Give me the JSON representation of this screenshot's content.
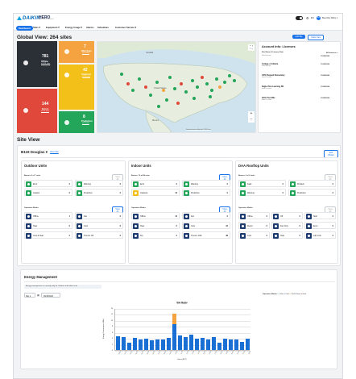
{
  "brand": {
    "logo": "DAIKIN",
    "product": "HERO",
    "product_sub": "Daikin Remote Operations"
  },
  "nav": {
    "items": [
      "Dashboard",
      "Sites ▾",
      "Equipment ▾",
      "Energy Usage ▾",
      "Alarms",
      "Schedules",
      "Customer Service ▾"
    ],
    "active": 0
  },
  "user": {
    "initials": "BW",
    "name": "Beverley Wiley ▾"
  },
  "global": {
    "title": "Global View: 264 sites",
    "add_site": "Add Site",
    "add_unit": "Scale View",
    "tiles": [
      {
        "num": "781",
        "label": "Offline",
        "sub": "of 465 sites",
        "color": "#2b2f36"
      },
      {
        "num": "7",
        "label": "Warnings",
        "sub": "at 5 sites",
        "color": "#f4a340"
      },
      {
        "num": "42",
        "label": "Cautions",
        "sub": "at 18 sites",
        "color": "#f3c019"
      },
      {
        "num": "144",
        "label": "Errors",
        "sub": "at 53 sites",
        "color": "#e0483c"
      },
      {
        "num": "8",
        "label": "Prediction",
        "sub": "at 5 sites",
        "color": "#23a55a"
      }
    ]
  },
  "map": {
    "labels": [
      "Canada",
      "United States",
      "Mexico"
    ],
    "zoom_in": "+",
    "zoom_out": "−",
    "footer": "Keyboard shortcuts  Map data ©2024  Terms"
  },
  "licenses": {
    "title": "Account Info: Licenses",
    "col_site": "Site Name & License Date",
    "col_action": "All licenses ▾",
    "rows": [
      {
        "name": "Site Name & License Date",
        "sub": "Initial license",
        "date": "11/28/2024"
      },
      {
        "name": "College of Atlanta",
        "sub": "Initial license",
        "date": "11/28/2024"
      },
      {
        "name": "CPS Shepard Elementary",
        "sub": "Initial License",
        "date": "11/28/2024"
      },
      {
        "name": "Eagle View Learning BE",
        "sub": "Initial License",
        "date": "11/28/2024"
      },
      {
        "name": "KCCI Tow Mile",
        "sub": "Initial License",
        "date": "11/28/2024"
      }
    ]
  },
  "site_view": {
    "title": "Site View",
    "site_name": "B119 Douglas ▾",
    "view_site": "View Site",
    "edit_widget": "Edit Widget"
  },
  "outdoor": {
    "title": "Outdoor Units",
    "alarms_label": "Alarms: 0 of 7 units",
    "view_all": "View All",
    "alarms": [
      {
        "t": "Error",
        "v": "0",
        "c": "#23a55a"
      },
      {
        "t": "Warning",
        "v": "0",
        "c": "#23a55a"
      },
      {
        "t": "Caution",
        "v": "0",
        "c": "#23a55a"
      },
      {
        "t": "Prediction",
        "v": "0",
        "c": "#23a55a"
      }
    ],
    "modes_label": "Operation Modes",
    "modes_view": "View All",
    "modes": [
      {
        "t": "Offline",
        "v": "1",
        "c": "#1d3b6f"
      },
      {
        "t": "Fan",
        "v": "0",
        "c": "#1d3b6f"
      },
      {
        "t": "Heat",
        "v": "0",
        "c": "#1d3b6f"
      },
      {
        "t": "Cool",
        "v": "6",
        "c": "#1d3b6f"
      },
      {
        "t": "Cool & Heat",
        "v": "0",
        "c": "#1d3b6f"
      },
      {
        "t": "Thermo Off",
        "v": "0",
        "c": "#1d3b6f"
      }
    ]
  },
  "indoor": {
    "title": "Indoor Units",
    "alarms_label": "Alarms: 13 of 84 units",
    "view_all": "View All",
    "alarms": [
      {
        "t": "Error",
        "v": "0",
        "c": "#23a55a"
      },
      {
        "t": "Warning",
        "v": "0",
        "c": "#23a55a"
      },
      {
        "t": "Cautions",
        "v": "13",
        "c": "#f3c019"
      },
      {
        "t": "Prediction",
        "v": "0",
        "c": "#23a55a"
      }
    ],
    "modes_label": "Operation Modes",
    "modes_view": "View All",
    "modes": [
      {
        "t": "Offline",
        "v": "12",
        "c": "#1d3b6f"
      },
      {
        "t": "Fan",
        "v": "0",
        "c": "#1d3b6f"
      },
      {
        "t": "Heat",
        "v": "0",
        "c": "#1d3b6f"
      },
      {
        "t": "Cool",
        "v": "34",
        "c": "#1d3b6f"
      },
      {
        "t": "Dry",
        "v": "0",
        "c": "#1d3b6f"
      },
      {
        "t": "Thermo OFF",
        "v": "38",
        "c": "#1d3b6f"
      }
    ]
  },
  "doas": {
    "title": "DAA Rooftop Units",
    "alarms_label": "Alarms: 0 of 0 units",
    "view_all": "View All",
    "alarms": [
      {
        "t": "Fault",
        "v": "0",
        "c": "#23a55a"
      },
      {
        "t": "Problem",
        "v": "0",
        "c": "#23a55a"
      },
      {
        "t": "Warning",
        "v": "0",
        "c": "#23a55a"
      },
      {
        "t": "Prediction",
        "v": "0",
        "c": "#23a55a"
      }
    ],
    "modes_label": "Operation Modes",
    "modes_view": "View All",
    "modes": [
      {
        "t": "Offline",
        "v": "0",
        "c": "#1d3b6f"
      },
      {
        "t": "Off",
        "v": "0",
        "c": "#1d3b6f"
      },
      {
        "t": "Start",
        "v": "0",
        "c": "#1d3b6f"
      },
      {
        "t": "Recirc",
        "v": "0",
        "c": "#1d3b6f"
      },
      {
        "t": "Fan Only",
        "v": "0",
        "c": "#1d3b6f"
      },
      {
        "t": "Econ",
        "v": "0",
        "c": "#1d3b6f"
      },
      {
        "t": "Cool",
        "v": "0",
        "c": "#1d3b6f"
      },
      {
        "t": "Heat",
        "v": "0",
        "c": "#1d3b6f"
      },
      {
        "t": "Lab Cntrl",
        "v": "0",
        "c": "#1d3b6f"
      }
    ]
  },
  "energy": {
    "title": "Energy Management",
    "notice": "Energy management is currently only for Outdoor and Indoor units.",
    "period": "Day",
    "date": "09/18/2024",
    "legend_label": "Operation Modes:",
    "legend": [
      {
        "name": "Fan",
        "color": "#23a55a"
      },
      {
        "name": "Cool",
        "color": "#1a6fd4"
      },
      {
        "name": "Cool & Heat",
        "color": "#f4a340"
      },
      {
        "name": "Heat",
        "color": "#e0483c"
      }
    ]
  },
  "chart_data": {
    "type": "bar",
    "title": "Site Name",
    "subtitle": "B119 Douglas",
    "ylabel": "Energy Consumption (kWh)",
    "xlabel": "Hours (EDT)",
    "ylim": [
      0,
      14
    ],
    "yticks": [
      "0",
      "2",
      "4",
      "6",
      "8",
      "10",
      "12",
      "14"
    ],
    "categories": [
      "00:00",
      "01:00",
      "02:00",
      "03:00",
      "04:00",
      "05:00",
      "06:00",
      "07:00",
      "08:00",
      "09:00",
      "10:00",
      "11:00",
      "12:00",
      "13:00",
      "14:00",
      "15:00",
      "16:00",
      "17:00",
      "18:00",
      "19:00",
      "20:00",
      "21:00",
      "22:00",
      "23:00"
    ],
    "series": [
      {
        "name": "Cool",
        "values": [
          4.5,
          4.2,
          2.5,
          4.0,
          3.5,
          3.8,
          3.2,
          3.6,
          3.4,
          4.0,
          8.5,
          4.8,
          4.2,
          5.0,
          3.9,
          4.1,
          3.6,
          4.2,
          2.5,
          3.8,
          3.4,
          3.6,
          2.8,
          3.9
        ]
      },
      {
        "name": "Cool & Heat",
        "values": [
          0,
          0,
          0,
          0,
          0,
          0,
          0,
          0,
          0,
          0,
          3.5,
          0,
          0,
          0,
          0,
          0,
          0,
          0,
          0,
          0,
          0,
          0,
          0,
          0
        ]
      }
    ]
  }
}
